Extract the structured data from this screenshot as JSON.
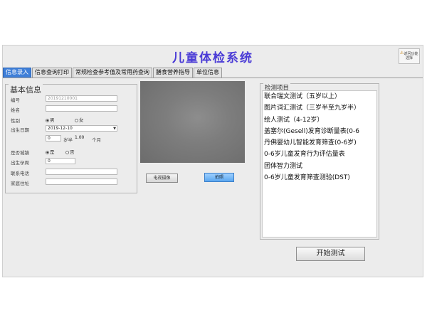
{
  "app": {
    "title": "儿童体检系统"
  },
  "corner": {
    "line1": "返回功能",
    "line2": "选择"
  },
  "tabs": [
    "信息录入",
    "信息查询打印",
    "常规检查参考值及常用药查询",
    "膳食营养指导",
    "单位信息"
  ],
  "basic_info": {
    "legend": "基本信息",
    "id_label": "编号",
    "id_value": "20191210001",
    "name_label": "姓名",
    "name_value": "",
    "gender_label": "性别",
    "gender_options": [
      "男",
      "女"
    ],
    "gender_selected": "男",
    "dob_label": "出生日期",
    "dob_value": "2019-12-10",
    "age_years": "0",
    "age_years_unit": "岁半",
    "age_months": "1.00",
    "age_months_unit": "个月",
    "premature_label": "是否城镇",
    "premature_options": [
      "是",
      "否"
    ],
    "premature_selected": "是",
    "gestation_label": "出生孕周",
    "gestation_value": "0",
    "phone_label": "联系电话",
    "address_label": "家庭住址"
  },
  "camera": {
    "open_button": "电视摄像",
    "capture_button": "拍照"
  },
  "tests": {
    "legend": "检测项目",
    "items": [
      "联合瑞文测试（五岁以上）",
      "图片词汇测试（三岁半至九岁半）",
      "绘人测试（4-12岁）",
      "盖塞尔(Gesell)发育诊断量表(0-6",
      "丹佛婴幼儿智能发育筛查(0-6岁)",
      "0-6岁儿童发育行为评估量表",
      "团体智力测试",
      "0-6岁儿童发育筛查测验(DST)"
    ]
  },
  "start_button": "开始测试"
}
